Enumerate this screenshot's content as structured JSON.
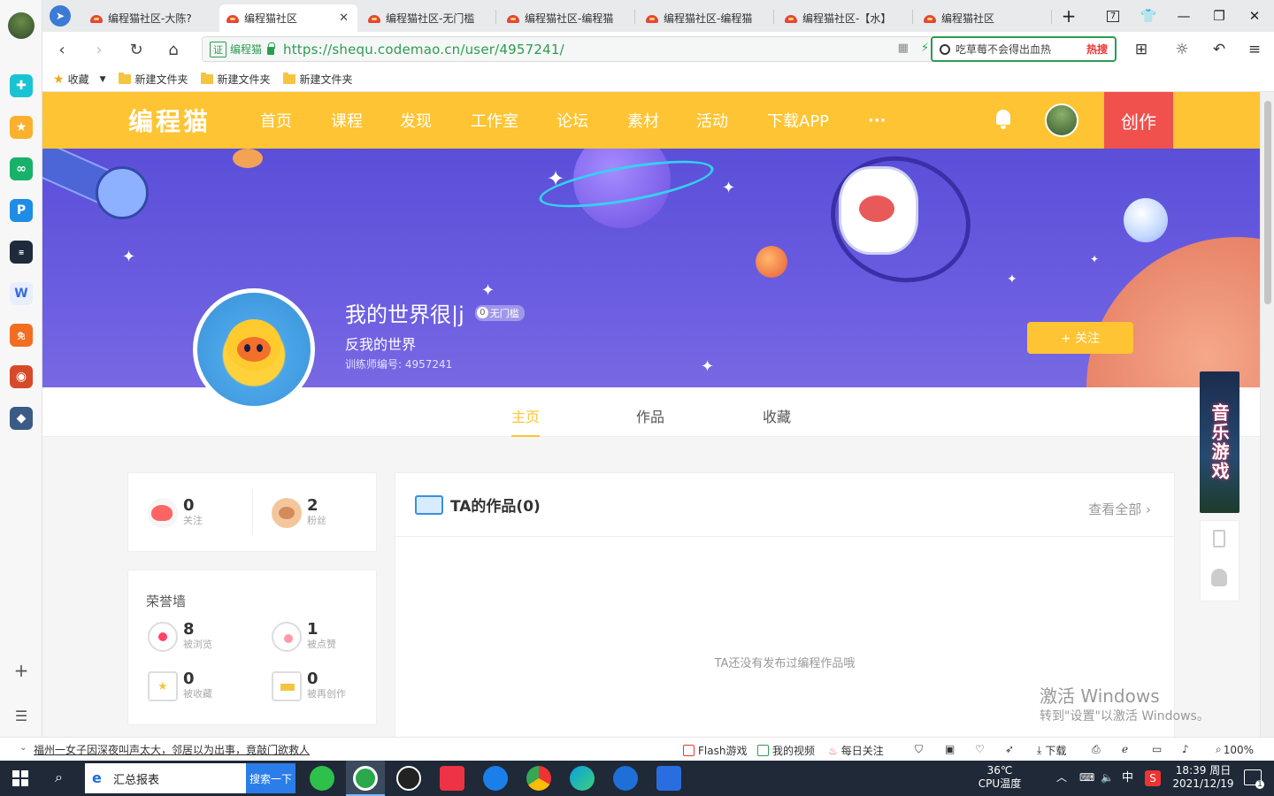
{
  "browser": {
    "tabs": [
      {
        "title": "编程猫社区-大陈?",
        "active": false
      },
      {
        "title": "编程猫社区",
        "active": true
      },
      {
        "title": "编程猫社区-无门槛",
        "active": false
      },
      {
        "title": "编程猫社区-编程猫",
        "active": false
      },
      {
        "title": "编程猫社区-编程猫",
        "active": false
      },
      {
        "title": "编程猫社区-【水】",
        "active": false
      },
      {
        "title": "编程猫社区",
        "active": false
      }
    ],
    "tab_count": "7",
    "cert_label": "证",
    "cert_name": "编程猫",
    "url": "https://shequ.codemao.cn/user/4957241/",
    "search_text": "吃草莓不会得出血热",
    "search_hot": "热搜",
    "bookmarks": [
      "收藏",
      "新建文件夹",
      "新建文件夹",
      "新建文件夹"
    ]
  },
  "site": {
    "logo": "编程猫",
    "nav": [
      "首页",
      "课程",
      "发现",
      "工作室",
      "论坛",
      "素材",
      "活动",
      "下载APP",
      "···"
    ],
    "create": "创作"
  },
  "profile": {
    "name": "我的世界很|j",
    "badge_num": "0",
    "badge_text": "无门槛",
    "signature": "反我的世界",
    "trainer_id": "训练师编号: 4957241",
    "follow": "+ 关注",
    "tabs": [
      "主页",
      "作品",
      "收藏"
    ]
  },
  "stats": {
    "following": {
      "value": "0",
      "label": "关注"
    },
    "fans": {
      "value": "2",
      "label": "粉丝"
    }
  },
  "honor": {
    "title": "荣誉墙",
    "items": [
      {
        "value": "8",
        "label": "被浏览"
      },
      {
        "value": "1",
        "label": "被点赞"
      },
      {
        "value": "0",
        "label": "被收藏"
      },
      {
        "value": "0",
        "label": "被再创作"
      }
    ]
  },
  "works": {
    "title": "TA的作品(0)",
    "view_all": "查看全部",
    "empty": "TA还没有发布过编程作品哦"
  },
  "float_ad": "音乐游戏",
  "watermark": {
    "line1": "激活 Windows",
    "line2": "转到\"设置\"以激活 Windows。"
  },
  "statusbar": {
    "news": "福州一女子因深夜叫声太大，邻居以为出事，竟敲门欲救人",
    "flash": "Flash游戏",
    "video": "我的视频",
    "daily": "每日关注",
    "download": "下载",
    "zoom": "100%"
  },
  "taskbar": {
    "search_text": "汇总报表",
    "search_btn": "搜索一下",
    "temp": "36℃",
    "temp_label": "CPU温度",
    "ime": "中",
    "time": "18:39 周日",
    "date": "2021/12/19",
    "notif": "1"
  }
}
